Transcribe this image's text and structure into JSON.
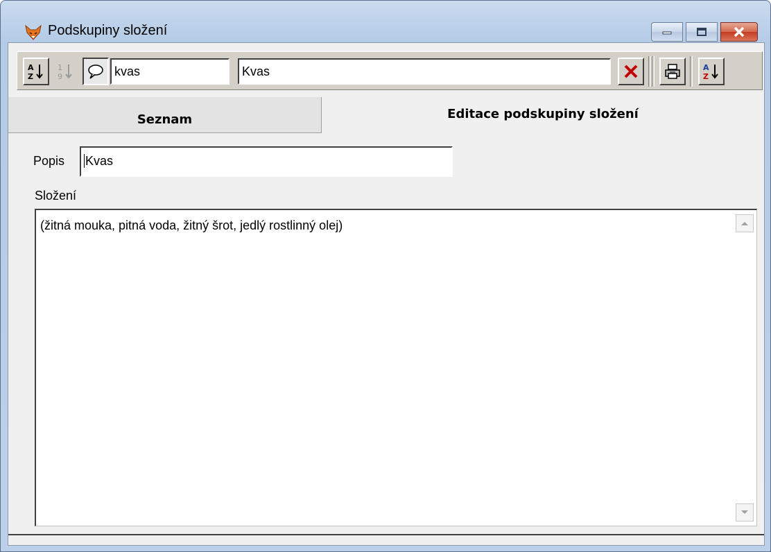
{
  "window": {
    "title": "Podskupiny složení",
    "icon": "fox-icon",
    "controls": [
      "minimize-icon",
      "maximize-icon",
      "close-icon"
    ]
  },
  "toolbar": {
    "sort_az": "A↓Z",
    "sort_19": "1↓9",
    "comment_icon": "speech-bubble-icon",
    "code_field": "kvas",
    "name_field": "Kvas",
    "delete_icon": "red-x-icon",
    "print_icon": "printer-icon",
    "sort_az2": "A↓Z"
  },
  "tabs": [
    {
      "label": "Seznam",
      "active": false
    },
    {
      "label": "Editace podskupiny složení",
      "active": true
    }
  ],
  "form": {
    "popis_label": "Popis",
    "popis_value": "Kvas",
    "slozeni_label": "Složení",
    "slozeni_value": "(žitná mouka, pitná voda, žitný šrot, jedlý rostlinný olej)"
  },
  "colors": {
    "delete": "#c00000",
    "window_frame": "#b4cbe6",
    "close_button": "#c43c22"
  }
}
